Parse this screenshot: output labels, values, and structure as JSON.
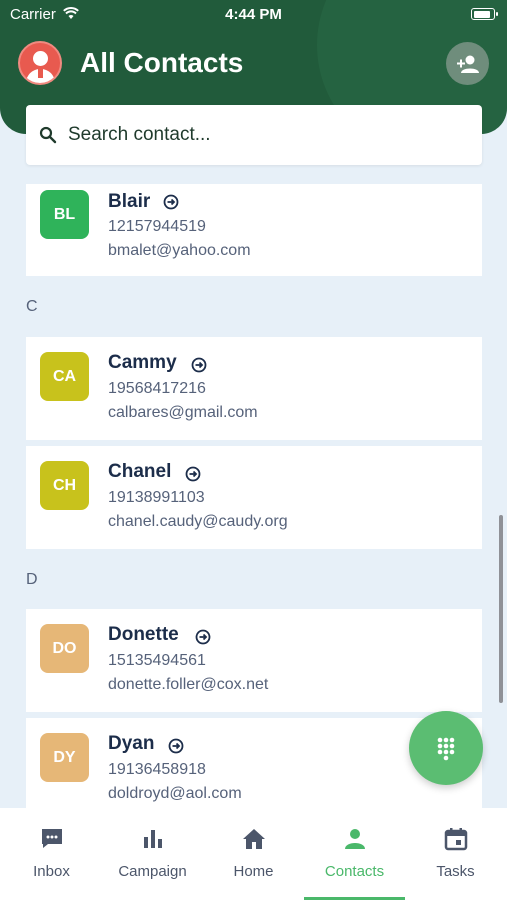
{
  "status_bar": {
    "carrier": "Carrier",
    "time": "4:44 PM"
  },
  "header": {
    "title": "All Contacts"
  },
  "search": {
    "placeholder": "Search contact..."
  },
  "sections": {
    "c": "C",
    "d": "D"
  },
  "contacts": [
    {
      "initials": "BL",
      "name": "Blair",
      "phone": "12157944519",
      "email": "bmalet@yahoo.com",
      "color": "#2fb35a"
    },
    {
      "initials": "CA",
      "name": "Cammy",
      "phone": "19568417216",
      "email": "calbares@gmail.com",
      "color": "#c8c21c"
    },
    {
      "initials": "CH",
      "name": "Chanel",
      "phone": "19138991103",
      "email": "chanel.caudy@caudy.org",
      "color": "#c8c21c"
    },
    {
      "initials": "DO",
      "name": "Donette",
      "phone": "15135494561",
      "email": "donette.foller@cox.net",
      "color": "#e6b777"
    },
    {
      "initials": "DY",
      "name": "Dyan",
      "phone": "19136458918",
      "email": "doldroyd@aol.com",
      "color": "#e6b777"
    }
  ],
  "nav": [
    {
      "label": "Inbox",
      "icon": "inbox-chat-icon"
    },
    {
      "label": "Campaign",
      "icon": "bar-chart-icon"
    },
    {
      "label": "Home",
      "icon": "home-icon"
    },
    {
      "label": "Contacts",
      "icon": "person-icon",
      "active": true
    },
    {
      "label": "Tasks",
      "icon": "calendar-icon"
    }
  ],
  "colors": {
    "header": "#215b3b",
    "accent": "#4ab86a",
    "background": "#e7f0f8"
  }
}
